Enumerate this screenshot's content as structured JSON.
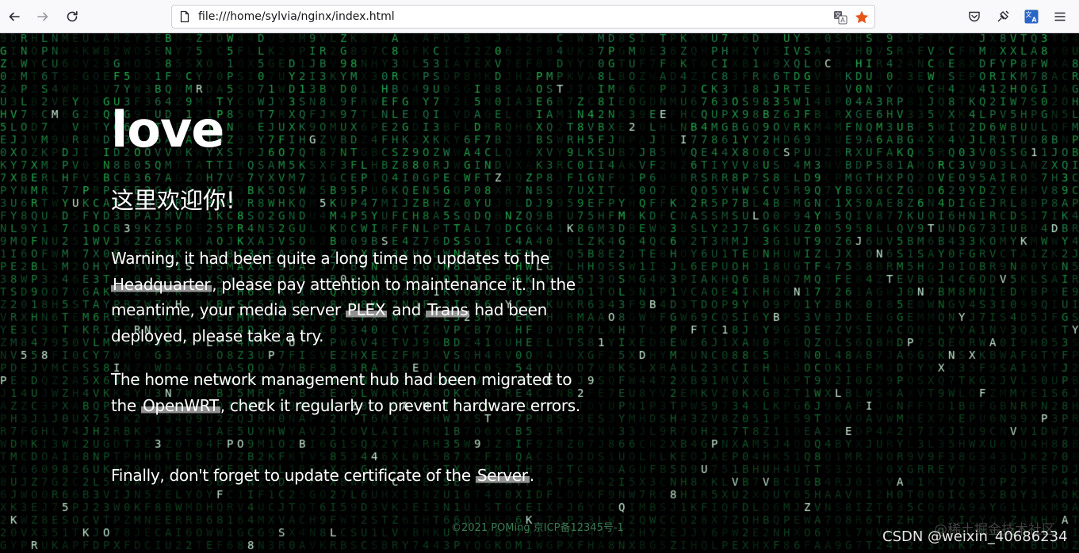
{
  "browser": {
    "url": "file:///home/sylvia/nginx/index.html"
  },
  "page": {
    "title": "love",
    "subtitle": "这里欢迎你!",
    "paragraph1": {
      "t1": "Warning, it had been quite a long time no updates to the ",
      "link1": "Headquarter",
      "t2": ", please pay attention to maintenance it. In the meantime, your media server ",
      "link2": "PLEX",
      "t3": " and ",
      "link3": "Trans",
      "t4": " had been deployed, please take a try."
    },
    "paragraph2": {
      "t1": "The home network management hub had been migrated to the ",
      "link1": "OpenWRT",
      "t2": ", check it regularly to prevent hardware errors."
    },
    "paragraph3": {
      "t1": "Finally, don't forget to update certificate of the ",
      "link1": "Server",
      "t2": "."
    },
    "footer": "©2021 POMing 京ICP备12345号-1"
  },
  "watermarks": {
    "site": "@稀土掘金技术社区",
    "author": "CSDN @weixin_40686234"
  },
  "colors": {
    "rain": "#2fbf6a",
    "background": "#000000",
    "star": "#e8541c"
  },
  "icons": [
    "back-icon",
    "forward-icon",
    "reload-icon",
    "page-icon",
    "translate-icon",
    "bookmark-star-icon",
    "pocket-icon",
    "extension-icon",
    "translate-extension-icon",
    "menu-icon"
  ]
}
